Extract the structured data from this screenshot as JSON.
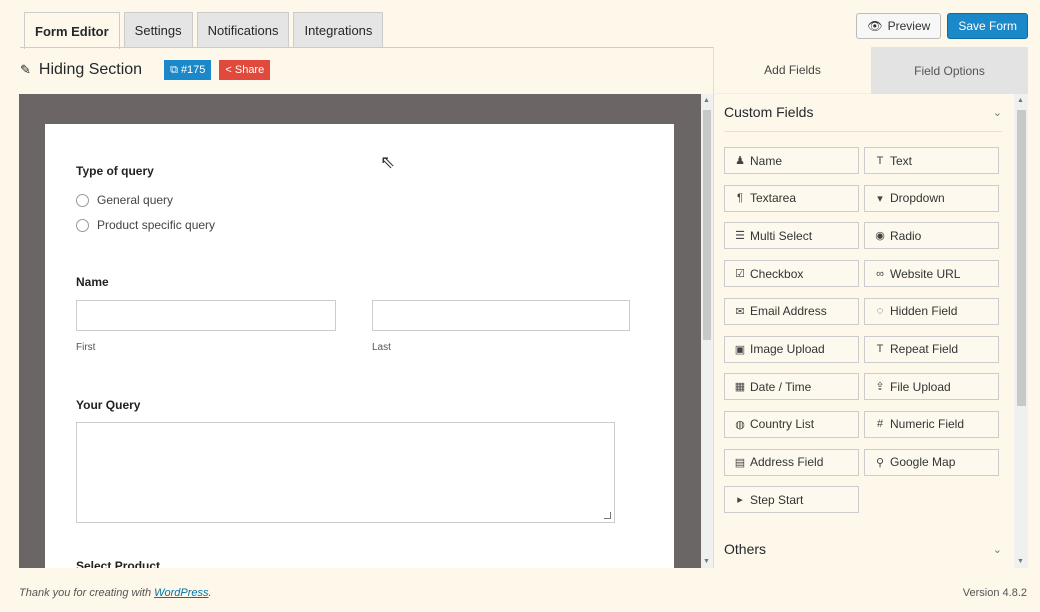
{
  "tabs": [
    {
      "label": "Form Editor",
      "active": true
    },
    {
      "label": "Settings",
      "active": false
    },
    {
      "label": "Notifications",
      "active": false
    },
    {
      "label": "Integrations",
      "active": false
    }
  ],
  "actions": {
    "preview_label": "Preview",
    "save_label": "Save Form"
  },
  "form_title": "Hiding Section",
  "form_id_badge": "#175",
  "share_label": "Share",
  "form": {
    "type_of_query": {
      "label": "Type of query",
      "options": [
        "General query",
        "Product specific query"
      ]
    },
    "name": {
      "label": "Name",
      "first_sub": "First",
      "last_sub": "Last"
    },
    "query": {
      "label": "Your Query"
    },
    "select_product": {
      "label": "Select Product"
    }
  },
  "panel": {
    "tabs": [
      "Add Fields",
      "Field Options"
    ],
    "custom_fields_title": "Custom Fields",
    "fields": [
      {
        "label": "Name",
        "icon": "user-icon"
      },
      {
        "label": "Text",
        "icon": "text-icon"
      },
      {
        "label": "Textarea",
        "icon": "paragraph-icon"
      },
      {
        "label": "Dropdown",
        "icon": "dropdown-icon"
      },
      {
        "label": "Multi Select",
        "icon": "list-icon"
      },
      {
        "label": "Radio",
        "icon": "radio-icon"
      },
      {
        "label": "Checkbox",
        "icon": "checkbox-icon"
      },
      {
        "label": "Website URL",
        "icon": "link-icon"
      },
      {
        "label": "Email Address",
        "icon": "envelope-icon"
      },
      {
        "label": "Hidden Field",
        "icon": "eye-slash-icon"
      },
      {
        "label": "Image Upload",
        "icon": "image-icon"
      },
      {
        "label": "Repeat Field",
        "icon": "text-icon"
      },
      {
        "label": "Date / Time",
        "icon": "calendar-icon"
      },
      {
        "label": "File Upload",
        "icon": "upload-icon"
      },
      {
        "label": "Country List",
        "icon": "globe-icon"
      },
      {
        "label": "Numeric Field",
        "icon": "hash-icon"
      },
      {
        "label": "Address Field",
        "icon": "address-card-icon"
      },
      {
        "label": "Google Map",
        "icon": "map-marker-icon"
      },
      {
        "label": "Step Start",
        "icon": "step-icon"
      }
    ],
    "others_title": "Others"
  },
  "footer": {
    "thanks_prefix": "Thank you for creating with ",
    "wordpress_link": "WordPress",
    "thanks_suffix": ".",
    "version": "Version 4.8.2"
  }
}
